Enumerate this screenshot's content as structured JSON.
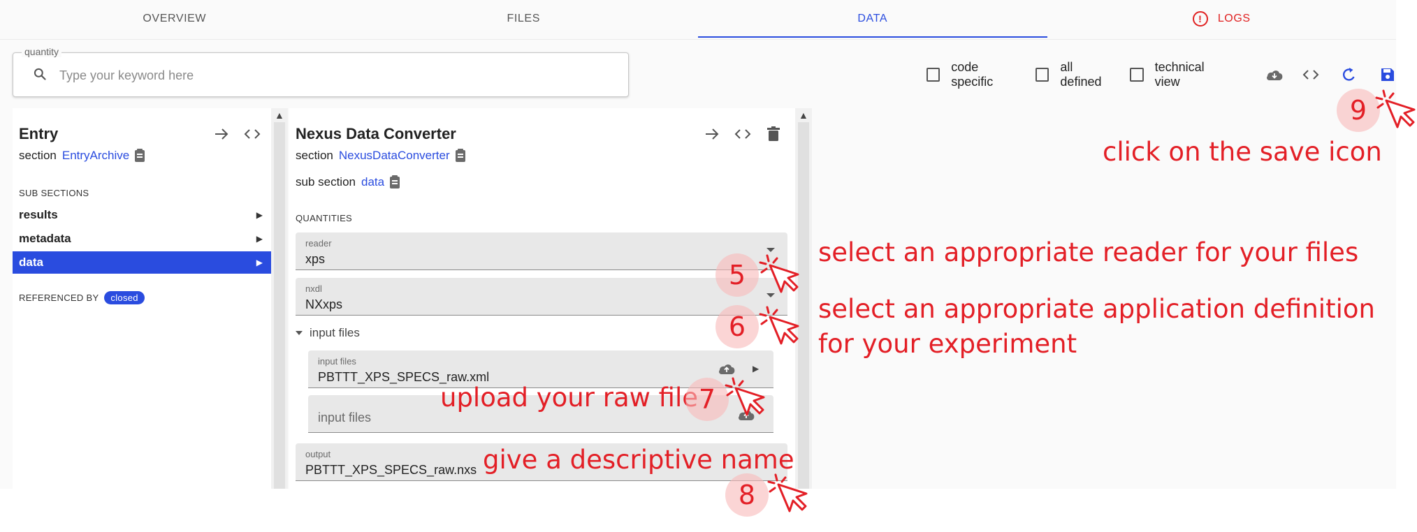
{
  "tabs": [
    {
      "label": "OVERVIEW"
    },
    {
      "label": "FILES"
    },
    {
      "label": "DATA"
    },
    {
      "label": "LOGS"
    }
  ],
  "search": {
    "legend": "quantity",
    "placeholder": "Type your keyword here",
    "value": ""
  },
  "toolbar": {
    "code_specific": "code specific",
    "all_defined": "all defined",
    "technical_view": "technical view"
  },
  "left_panel": {
    "title": "Entry",
    "section_label": "section",
    "section_link": "EntryArchive",
    "sub_sections_heading": "SUB SECTIONS",
    "items": [
      {
        "label": "results"
      },
      {
        "label": "metadata"
      },
      {
        "label": "data"
      }
    ],
    "referenced_by": "REFERENCED BY",
    "referenced_badge": "closed"
  },
  "mid_panel": {
    "title": "Nexus Data Converter",
    "section_label": "section",
    "section_link": "NexusDataConverter",
    "sub_section_label": "sub section",
    "sub_section_link": "data",
    "quantities_heading": "QUANTITIES",
    "reader": {
      "label": "reader",
      "value": "xps"
    },
    "nxdl": {
      "label": "nxdl",
      "value": "NXxps"
    },
    "input_files_group": "input files",
    "input_file_1": {
      "label": "input files",
      "value": "PBTTT_XPS_SPECS_raw.xml"
    },
    "input_file_2": {
      "placeholder": "input files"
    },
    "output": {
      "label": "output",
      "value": "PBTTT_XPS_SPECS_raw.nxs"
    }
  },
  "annotations": {
    "step5": {
      "number": "5",
      "text": "select an appropriate reader for your files"
    },
    "step6": {
      "number": "6",
      "text_line1": "select an appropriate application definition",
      "text_line2": "for your experiment"
    },
    "step7": {
      "number": "7",
      "text": "upload your raw file"
    },
    "step8": {
      "number": "8",
      "text": "give a descriptive name"
    },
    "step9": {
      "number": "9",
      "text": "click on the save icon"
    }
  },
  "colors": {
    "accent": "#2a4cdf",
    "annotation": "#e31f26",
    "error": "#e02020"
  },
  "icons": {
    "search": "search-icon",
    "download": "cloud-download-icon",
    "code": "code-icon",
    "reload": "reload-icon",
    "save": "save-icon",
    "navigate": "arrow-right-icon",
    "delete": "delete-icon",
    "upload": "cloud-upload-icon",
    "clipboard": "clipboard-icon",
    "cursor": "click-cursor-icon"
  }
}
